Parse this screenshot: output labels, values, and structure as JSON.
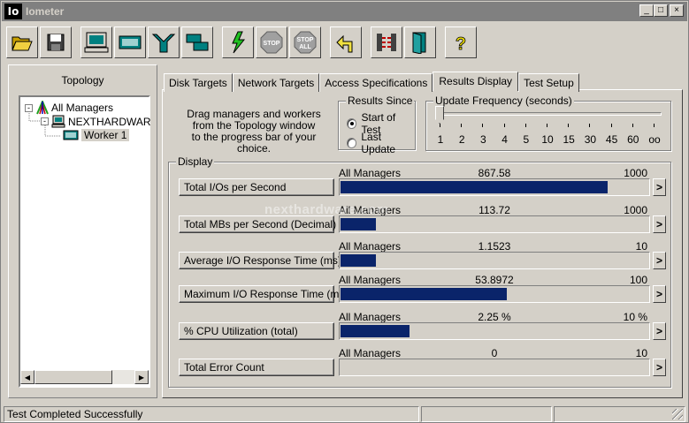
{
  "window": {
    "title": "Iometer",
    "icon_text": "Io"
  },
  "title_buttons": {
    "minimize": "_",
    "maximize": "□",
    "close": "×"
  },
  "toolbar": {
    "buttons": [
      {
        "name": "open-icon"
      },
      {
        "name": "save-icon"
      },
      {
        "name": "new-manager-icon"
      },
      {
        "name": "new-disk-worker-icon"
      },
      {
        "name": "new-network-worker-icon"
      },
      {
        "name": "duplicate-worker-icon"
      },
      {
        "name": "start-icon"
      },
      {
        "name": "stop-icon",
        "label": "STOP"
      },
      {
        "name": "stop-all-icon",
        "label_top": "STOP",
        "label_bottom": "ALL"
      },
      {
        "name": "reset-workers-icon"
      },
      {
        "name": "disconnect-icon"
      },
      {
        "name": "exit-icon"
      },
      {
        "name": "help-icon",
        "label": "?"
      }
    ]
  },
  "topology": {
    "title": "Topology",
    "items": [
      {
        "label": "All Managers",
        "expander": "-"
      },
      {
        "label": "NEXTHARDWAR",
        "expander": "-"
      },
      {
        "label": "Worker 1"
      }
    ]
  },
  "tabs": [
    {
      "label": "Disk Targets"
    },
    {
      "label": "Network Targets"
    },
    {
      "label": "Access Specifications"
    },
    {
      "label": "Results Display",
      "active": true
    },
    {
      "label": "Test Setup"
    }
  ],
  "instructions": {
    "line1": "Drag managers and workers",
    "line2": "from the Topology window",
    "line3": "to the progress bar of your choice."
  },
  "results_since": {
    "label": "Results Since",
    "options": [
      {
        "label": "Start of Test",
        "selected": true
      },
      {
        "label": "Last Update",
        "selected": false
      }
    ]
  },
  "update_frequency": {
    "label": "Update Frequency (seconds)",
    "ticks": [
      "1",
      "2",
      "3",
      "4",
      "5",
      "10",
      "15",
      "30",
      "45",
      "60",
      "oo"
    ],
    "selected_index": 0
  },
  "display": {
    "label": "Display",
    "metrics": [
      {
        "button": "Total I/Os per Second",
        "source": "All Managers",
        "value": "867.58",
        "max": "1000",
        "fraction": 0.8676,
        "more": ">"
      },
      {
        "button": "Total MBs per Second (Decimal)",
        "source": "All Managers",
        "value": "113.72",
        "max": "1000",
        "fraction": 0.1137,
        "more": ">"
      },
      {
        "button": "Average I/O Response Time (ms)",
        "source": "All Managers",
        "value": "1.1523",
        "max": "10",
        "fraction": 0.1152,
        "more": ">"
      },
      {
        "button": "Maximum I/O Response Time (ms)",
        "source": "All Managers",
        "value": "53.8972",
        "max": "100",
        "fraction": 0.539,
        "more": ">"
      },
      {
        "button": "% CPU Utilization (total)",
        "source": "All Managers",
        "value": "2.25 %",
        "max": "10 %",
        "fraction": 0.225,
        "more": ">"
      },
      {
        "button": "Total Error Count",
        "source": "All Managers",
        "value": "0",
        "max": "10",
        "fraction": 0,
        "more": ">"
      }
    ]
  },
  "watermark": "nexthardware.com",
  "status": {
    "text": "Test Completed Successfully"
  },
  "colors": {
    "bar": "#0a246a",
    "title_inactive": "#808080"
  }
}
